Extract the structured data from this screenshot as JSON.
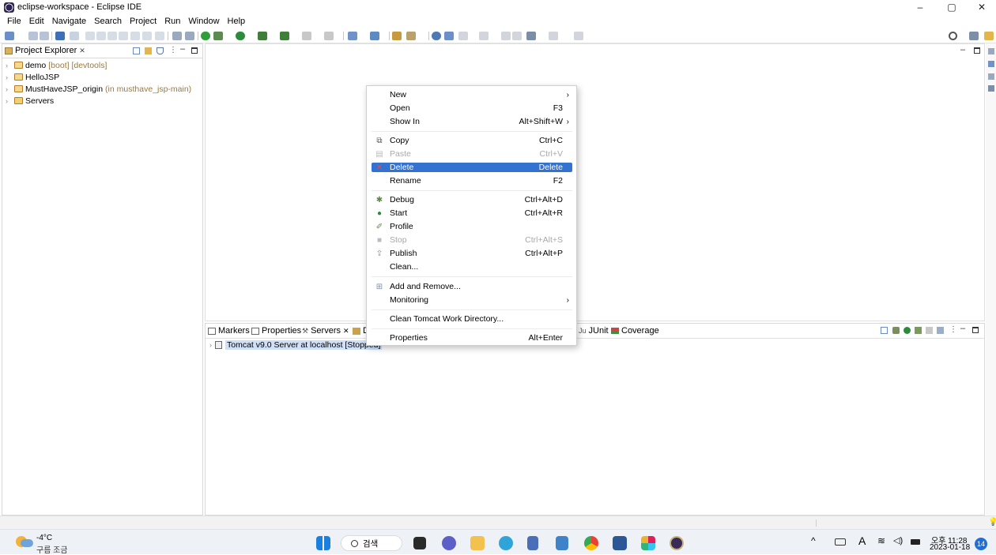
{
  "window": {
    "title": "eclipse-workspace - Eclipse IDE",
    "minimize": "–",
    "maximize": "▢",
    "close": "✕"
  },
  "menubar": [
    "File",
    "Edit",
    "Navigate",
    "Search",
    "Project",
    "Run",
    "Window",
    "Help"
  ],
  "project_explorer": {
    "tab_label": "Project Explorer",
    "tab_close": "✕",
    "items": [
      {
        "name": "demo",
        "decoration": "[boot] [devtools]"
      },
      {
        "name": "HelloJSP",
        "decoration": ""
      },
      {
        "name": "MustHaveJSP_origin",
        "decoration": "(in musthave_jsp-main)"
      },
      {
        "name": "Servers",
        "decoration": ""
      }
    ]
  },
  "bottom_panel": {
    "tabs": [
      "Markers",
      "Properties",
      "Servers",
      "D",
      "JUnit",
      "Coverage"
    ],
    "active_tab": "Servers",
    "server_entry": "Tomcat v9.0 Server at localhost",
    "server_state": "[Stopped]"
  },
  "context_menu": {
    "items": [
      {
        "label": "New",
        "shortcut": "",
        "submenu": true,
        "icon": "",
        "disabled": false
      },
      {
        "label": "Open",
        "shortcut": "F3",
        "submenu": false,
        "icon": "",
        "disabled": false
      },
      {
        "label": "Show In",
        "shortcut": "Alt+Shift+W",
        "submenu": true,
        "icon": "",
        "disabled": false
      },
      {
        "label": "Copy",
        "shortcut": "Ctrl+C",
        "submenu": false,
        "icon": "copy-icon",
        "disabled": false
      },
      {
        "label": "Paste",
        "shortcut": "Ctrl+V",
        "submenu": false,
        "icon": "paste-icon",
        "disabled": true
      },
      {
        "label": "Delete",
        "shortcut": "Delete",
        "submenu": false,
        "icon": "delete-icon",
        "disabled": false,
        "highlighted": true
      },
      {
        "label": "Rename",
        "shortcut": "F2",
        "submenu": false,
        "icon": "",
        "disabled": false
      },
      {
        "label": "Debug",
        "shortcut": "Ctrl+Alt+D",
        "submenu": false,
        "icon": "debug-icon",
        "disabled": false
      },
      {
        "label": "Start",
        "shortcut": "Ctrl+Alt+R",
        "submenu": false,
        "icon": "start-icon",
        "disabled": false
      },
      {
        "label": "Profile",
        "shortcut": "",
        "submenu": false,
        "icon": "profile-icon",
        "disabled": false
      },
      {
        "label": "Stop",
        "shortcut": "Ctrl+Alt+S",
        "submenu": false,
        "icon": "stop-icon",
        "disabled": true
      },
      {
        "label": "Publish",
        "shortcut": "Ctrl+Alt+P",
        "submenu": false,
        "icon": "publish-icon",
        "disabled": false
      },
      {
        "label": "Clean...",
        "shortcut": "",
        "submenu": false,
        "icon": "",
        "disabled": false
      },
      {
        "label": "Add and Remove...",
        "shortcut": "",
        "submenu": false,
        "icon": "add-remove-icon",
        "disabled": false
      },
      {
        "label": "Monitoring",
        "shortcut": "",
        "submenu": true,
        "icon": "",
        "disabled": false
      },
      {
        "label": "Clean Tomcat Work Directory...",
        "shortcut": "",
        "submenu": false,
        "icon": "",
        "disabled": false
      },
      {
        "label": "Properties",
        "shortcut": "Alt+Enter",
        "submenu": false,
        "icon": "",
        "disabled": false
      }
    ]
  },
  "taskbar": {
    "weather_temp": "-4°C",
    "weather_desc": "구름 조금",
    "search_label": "검색",
    "time": "오후 11:28",
    "date": "2023-01-18",
    "notification_count": "14",
    "input_indicator": "A"
  },
  "colors": {
    "accent": "#3372d1",
    "decoration": "#9b7a3c"
  }
}
